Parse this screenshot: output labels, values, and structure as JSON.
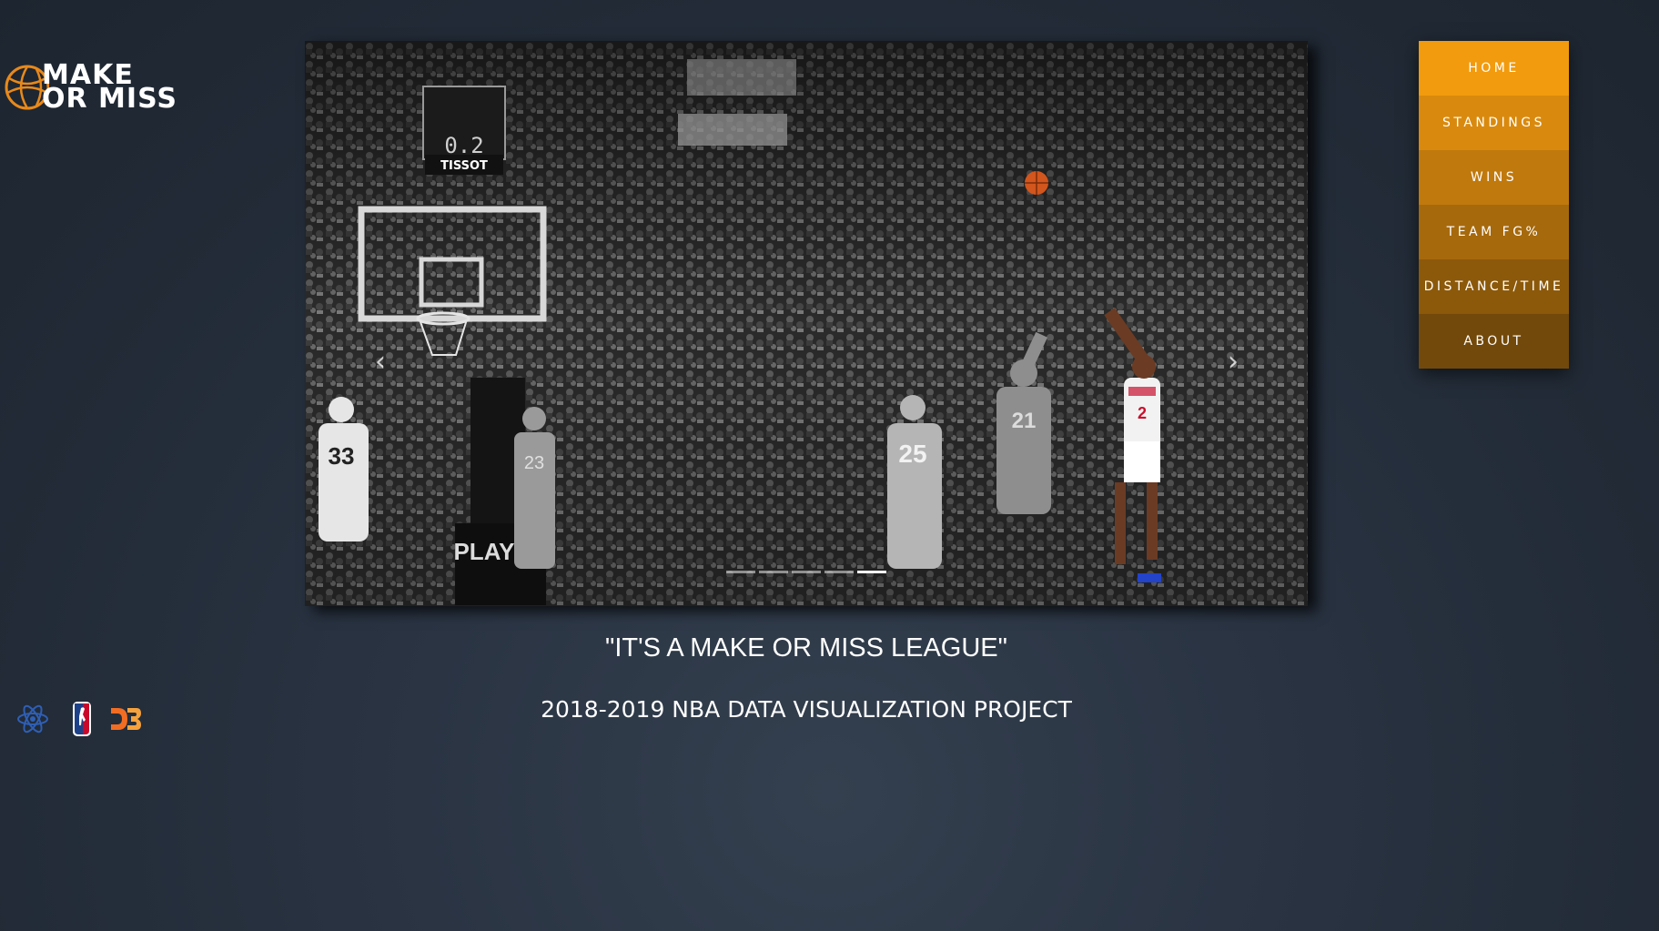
{
  "brand": {
    "logo_text": "MAKE OR MISS",
    "logo_line1": "MAKE",
    "logo_line2": "OR MISS",
    "accent_color": "#f29b0e"
  },
  "nav": {
    "items": [
      {
        "label": "HOME"
      },
      {
        "label": "STANDINGS"
      },
      {
        "label": "WINS"
      },
      {
        "label": "TEAM FG%"
      },
      {
        "label": "DISTANCE/TIME"
      },
      {
        "label": "ABOUT"
      }
    ]
  },
  "carousel": {
    "prev_icon": "chevron-left-icon",
    "next_icon": "chevron-right-icon",
    "slide_count": 5,
    "active_slide": 5,
    "scoreboard_clock": "0.2",
    "jersey_numbers": [
      "33",
      "23",
      "25",
      "21",
      "2"
    ]
  },
  "hero": {
    "quote": "\"IT'S A MAKE OR MISS LEAGUE\"",
    "subtitle": "2018-2019 NBA DATA VISUALIZATION PROJECT"
  },
  "tech_icons": [
    {
      "name": "react-icon",
      "color": "#2f5fb5"
    },
    {
      "name": "nba-logo-icon",
      "color": "#c9082a"
    },
    {
      "name": "d3-icon",
      "color": "#f26d22"
    }
  ]
}
